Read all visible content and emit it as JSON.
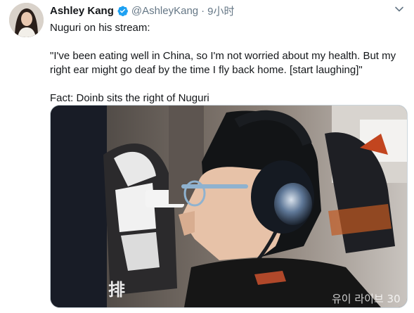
{
  "author": {
    "display_name": "Ashley Kang",
    "handle": "@AshleyKang",
    "separator": "·",
    "time": "9小时",
    "verified": true,
    "avatar_icon": "user-avatar"
  },
  "tweet": {
    "line1": "Nuguri on his stream:",
    "quote": "\"I've been eating well in China, so I'm not worried about my health. But my right ear might go deaf by the time I fly back home. [start laughing]\"",
    "fact": "Fact: Doinb sits the right of Nuguri"
  },
  "media": {
    "caption_left": "排",
    "caption_right": "유이 라이브 30"
  },
  "icons": {
    "verified": "verified-badge-icon",
    "menu": "chevron-down-icon"
  },
  "colors": {
    "verified_blue": "#1da1f2",
    "muted_text": "#657786",
    "border": "#ccd6dd"
  }
}
